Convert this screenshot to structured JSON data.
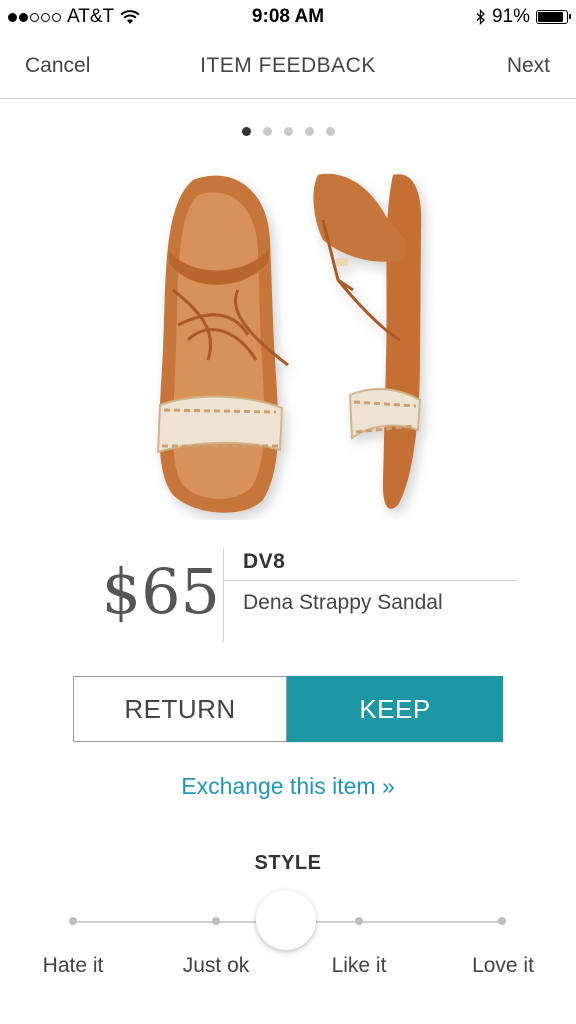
{
  "status_bar": {
    "carrier": "AT&T",
    "signal_bars_filled": 2,
    "signal_bars_total": 5,
    "time": "9:08 AM",
    "battery_percent_label": "91%",
    "battery_level": 0.91
  },
  "nav": {
    "cancel_label": "Cancel",
    "title": "ITEM FEEDBACK",
    "next_label": "Next"
  },
  "gallery": {
    "page_count": 5,
    "active_index": 0
  },
  "product": {
    "price": "$65",
    "brand": "DV8",
    "name": "Dena Strappy Sandal"
  },
  "actions": {
    "return_label": "RETURN",
    "keep_label": "KEEP",
    "selected": "KEEP",
    "exchange_label": "Exchange this item »"
  },
  "style_rating": {
    "title": "STYLE",
    "options": [
      "Hate it",
      "Just ok",
      "Like it",
      "Love it"
    ]
  },
  "colors": {
    "keep_teal": "#1c97a3",
    "link_blue": "#2196b8",
    "sandal_tan": "#c6763a",
    "sandal_cream": "#eee3d3"
  }
}
